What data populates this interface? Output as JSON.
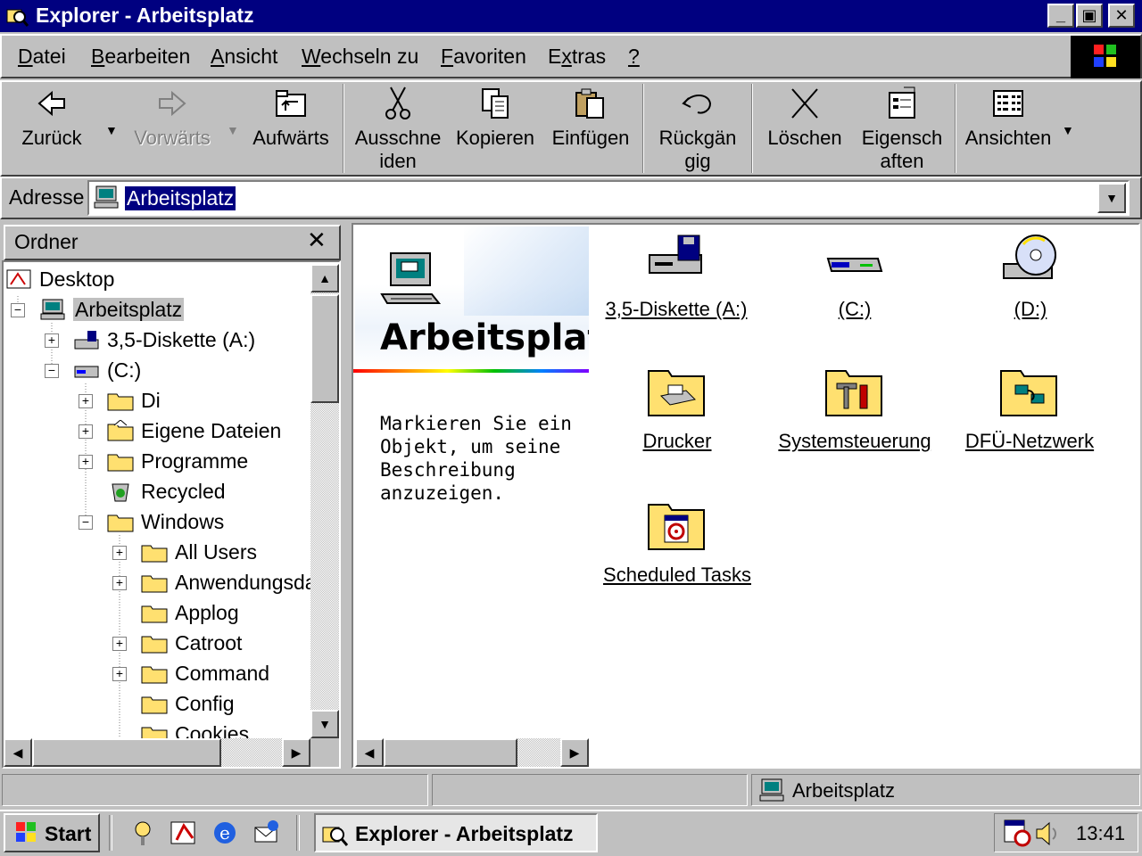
{
  "window": {
    "title": "Explorer - Arbeitsplatz",
    "caption_min": "_",
    "caption_max": "▣",
    "caption_close": "✕"
  },
  "menu": [
    {
      "label": "Datei",
      "key": "D"
    },
    {
      "label": "Bearbeiten",
      "key": "B"
    },
    {
      "label": "Ansicht",
      "key": "A"
    },
    {
      "label": "Wechseln zu",
      "key": "W"
    },
    {
      "label": "Favoriten",
      "key": "F"
    },
    {
      "label": "Extras",
      "key": "x"
    },
    {
      "label": "?",
      "key": "?"
    }
  ],
  "toolbar": {
    "back": "Zurück",
    "forward": "Vorwärts",
    "up": "Aufwärts",
    "cut": "Ausschne\niden",
    "copy": "Kopieren",
    "paste": "Einfügen",
    "undo": "Rückgän\ngig",
    "delete": "Löschen",
    "properties": "Eigensch\naften",
    "views": "Ansichten"
  },
  "address": {
    "label": "Adresse",
    "value": "Arbeitsplatz"
  },
  "folders": {
    "title": "Ordner",
    "close": "✕",
    "tree": [
      {
        "label": "Desktop"
      },
      {
        "label": "Arbeitsplatz"
      },
      {
        "label": "3,5-Diskette (A:)"
      },
      {
        "label": "(C:)"
      },
      {
        "label": "Di"
      },
      {
        "label": "Eigene Dateien"
      },
      {
        "label": "Programme"
      },
      {
        "label": "Recycled"
      },
      {
        "label": "Windows"
      },
      {
        "label": "All Users"
      },
      {
        "label": "Anwendungsda"
      },
      {
        "label": "Applog"
      },
      {
        "label": "Catroot"
      },
      {
        "label": "Command"
      },
      {
        "label": "Config"
      },
      {
        "label": "Cookies"
      }
    ]
  },
  "content": {
    "title": "Arbeitsplatz",
    "description": "Markieren Sie ein Objekt, um seine Beschreibung anzuzeigen.",
    "items": [
      {
        "label": "3,5-Diskette (A:)"
      },
      {
        "label": "(C:)"
      },
      {
        "label": "(D:)"
      },
      {
        "label": "Drucker"
      },
      {
        "label": "Systemsteuerung"
      },
      {
        "label": "DFÜ-Netzwerk"
      },
      {
        "label": "Scheduled Tasks"
      }
    ]
  },
  "statusbar": {
    "location": "Arbeitsplatz"
  },
  "taskbar": {
    "start": "Start",
    "task": "Explorer - Arbeitsplatz",
    "clock": "13:41"
  }
}
